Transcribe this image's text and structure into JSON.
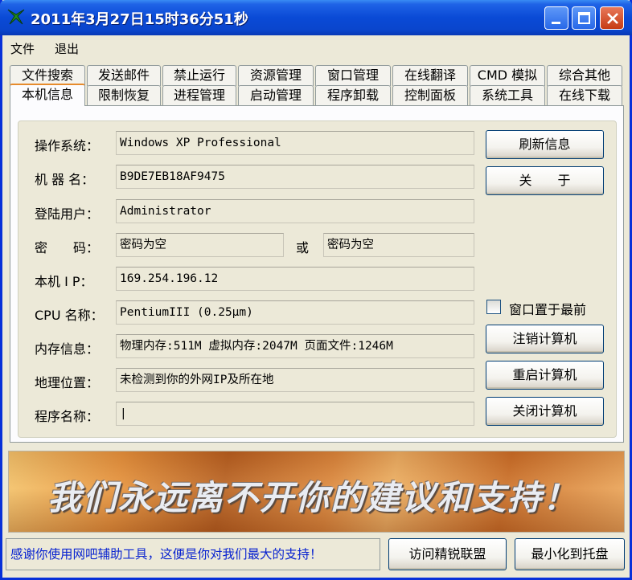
{
  "window": {
    "title": "2011年3月27日15时36分51秒"
  },
  "menu": [
    "文件",
    "退出"
  ],
  "tabs_row1": [
    "文件搜索",
    "发送邮件",
    "禁止运行",
    "资源管理",
    "窗口管理",
    "在线翻译",
    "CMD 模拟",
    "综合其他"
  ],
  "tabs_row2": [
    "本机信息",
    "限制恢复",
    "进程管理",
    "启动管理",
    "程序卸载",
    "控制面板",
    "系统工具",
    "在线下载"
  ],
  "active_tab": "本机信息",
  "info": {
    "os_label": "操作系统：",
    "os_value": "Windows XP Professional",
    "machine_label": "机 器 名：",
    "machine_value": "B9DE7EB18AF9475",
    "user_label": "登陆用户：",
    "user_value": "Administrator",
    "password_label": "密　　码：",
    "password_value1": "密码为空",
    "password_or": "或",
    "password_value2": "密码为空",
    "ip_label": "本机 I P：",
    "ip_value": "169.254.196.12",
    "cpu_label": "CPU 名称：",
    "cpu_value": "PentiumIII (0.25μm)",
    "mem_label": "内存信息：",
    "mem_value": "物理内存:511M  虚拟内存:2047M  页面文件:1246M",
    "geo_label": "地理位置：",
    "geo_value": "未检测到你的外网IP及所在地",
    "prog_label": "程序名称：",
    "prog_value": "|"
  },
  "buttons": {
    "refresh": "刷新信息",
    "about": "关　　于",
    "topmost_label": "窗口置于最前",
    "logoff": "注销计算机",
    "restart": "重启计算机",
    "shutdown": "关闭计算机",
    "visit": "访问精锐联盟",
    "minimize_tray": "最小化到托盘"
  },
  "banner_text": "我们永远离不开你的建议和支持！",
  "footer_message": "感谢你使用网吧辅助工具，这便是你对我们最大的支持！"
}
